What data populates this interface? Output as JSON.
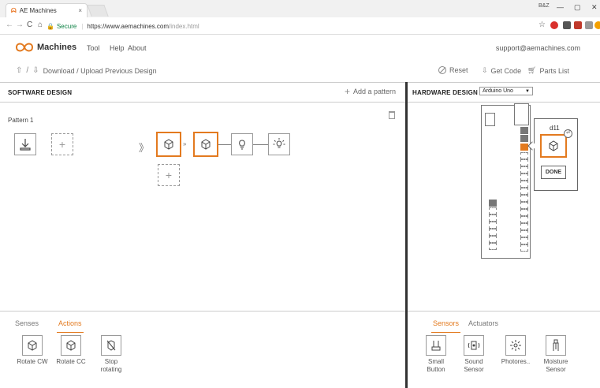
{
  "browser": {
    "tab_title": "AE Machines",
    "tab_close": "×",
    "secure_label": "Secure",
    "url_host": "https://www.aemachines.com",
    "url_path": "/index.html",
    "profile_label": "B&Z"
  },
  "app": {
    "brand": "Machines",
    "menu": {
      "tool": "Tool",
      "help": "Help",
      "about": "About"
    },
    "support": "support@aemachines.com",
    "toolbar": {
      "download_label": "Download / Upload Previous Design",
      "reset_label": "Reset",
      "getcode_label": "Get Code",
      "parts_label": "Parts List"
    },
    "accent": "#e37a1f"
  },
  "software_design": {
    "title": "SOFTWARE DESIGN",
    "add_pattern": "Add a pattern",
    "pattern_title": "Pattern 1",
    "chain": [
      "rotate-cw-icon",
      "rotate-cc-icon",
      "bulb-icon",
      "bulb-on-icon"
    ]
  },
  "hardware_design": {
    "title": "HARDWARE DESIGN",
    "board_select": "Arduino Uno",
    "popup_label": "d11",
    "done_label": "DONE"
  },
  "bottom_left": {
    "tabs": [
      "Senses",
      "Actions"
    ],
    "active_tab": "Actions",
    "items": [
      {
        "label": "Rotate CW",
        "icon": "rotate-cw-icon"
      },
      {
        "label": "Rotate CC",
        "icon": "rotate-cc-icon"
      },
      {
        "label": "Stop rotating",
        "icon": "stop-rotating-icon"
      }
    ]
  },
  "bottom_right": {
    "tabs": [
      "Sensors",
      "Actuators"
    ],
    "active_tab": "Sensors",
    "items": [
      {
        "label": "Small Button",
        "icon": "button-icon"
      },
      {
        "label": "Sound Sensor",
        "icon": "sound-sensor-icon"
      },
      {
        "label": "Photores..",
        "icon": "photoresistor-icon"
      },
      {
        "label": "Moisture Sensor",
        "icon": "moisture-sensor-icon"
      }
    ]
  }
}
